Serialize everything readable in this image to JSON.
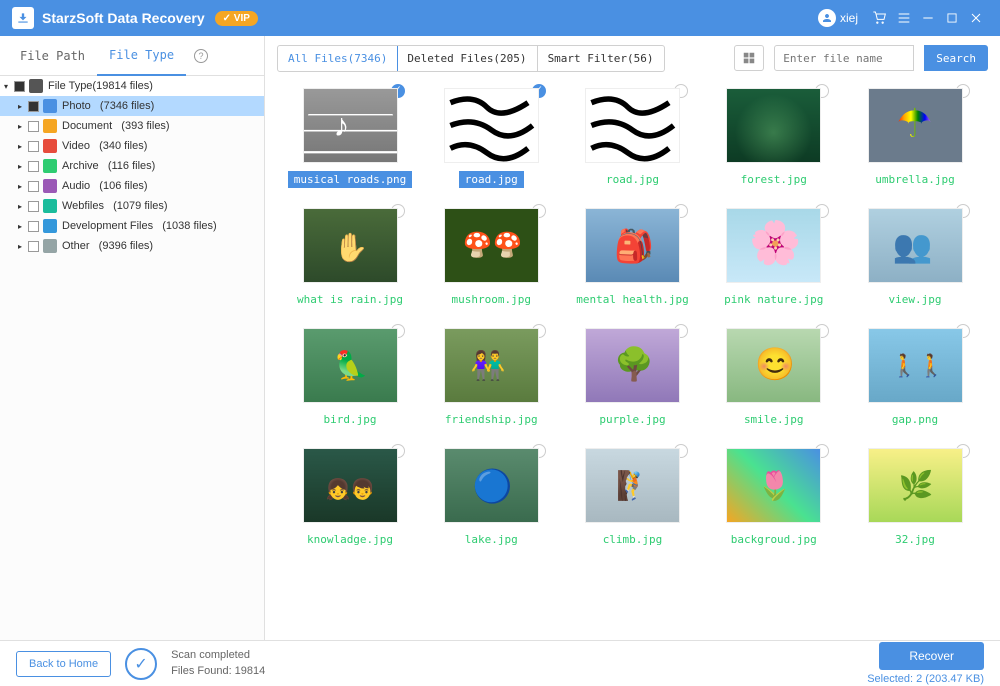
{
  "app": {
    "title": "StarzSoft Data Recovery",
    "vip": "VIP",
    "username": "xiej"
  },
  "sidebar": {
    "tabs": {
      "path": "File Path",
      "type": "File Type"
    },
    "root": "File Type(19814 files)",
    "items": [
      {
        "label": "Photo   (7346 files)",
        "color": "#4a90e2"
      },
      {
        "label": "Document   (393 files)",
        "color": "#f5a623"
      },
      {
        "label": "Video   (340 files)",
        "color": "#e74c3c"
      },
      {
        "label": "Archive   (116 files)",
        "color": "#2ecc71"
      },
      {
        "label": "Audio   (106 files)",
        "color": "#9b59b6"
      },
      {
        "label": "Webfiles   (1079 files)",
        "color": "#1abc9c"
      },
      {
        "label": "Development Files   (1038 files)",
        "color": "#3498db"
      },
      {
        "label": "Other   (9396 files)",
        "color": "#95a5a6"
      }
    ]
  },
  "toolbar": {
    "filters": {
      "all": "All Files(7346)",
      "deleted": "Deleted  Files(205)",
      "smart": "Smart Filter(56)"
    },
    "search_placeholder": "Enter file name",
    "search_btn": "Search"
  },
  "grid": [
    [
      {
        "name": "musical roads.png",
        "cls": "t-road",
        "selected": true
      },
      {
        "name": "road.jpg",
        "cls": "t-curves",
        "selected": true
      },
      {
        "name": "road.jpg",
        "cls": "t-curves",
        "selected": false
      },
      {
        "name": "forest.jpg",
        "cls": "t-forest",
        "selected": false
      },
      {
        "name": "umbrella.jpg",
        "cls": "t-umbrella",
        "selected": false
      }
    ],
    [
      {
        "name": "what is rain.jpg",
        "cls": "t-rain",
        "selected": false
      },
      {
        "name": "mushroom.jpg",
        "cls": "t-mushroom",
        "selected": false
      },
      {
        "name": "mental health.jpg",
        "cls": "t-mental",
        "selected": false
      },
      {
        "name": "pink nature.jpg",
        "cls": "t-pink",
        "selected": false
      },
      {
        "name": "view.jpg",
        "cls": "t-view",
        "selected": false
      }
    ],
    [
      {
        "name": "bird.jpg",
        "cls": "t-bird",
        "selected": false
      },
      {
        "name": "friendship.jpg",
        "cls": "t-friend",
        "selected": false
      },
      {
        "name": "purple.jpg",
        "cls": "t-purple",
        "selected": false
      },
      {
        "name": "smile.jpg",
        "cls": "t-smile",
        "selected": false
      },
      {
        "name": "gap.png",
        "cls": "t-gap",
        "selected": false
      }
    ],
    [
      {
        "name": "knowladge.jpg",
        "cls": "t-know",
        "selected": false
      },
      {
        "name": "lake.jpg",
        "cls": "t-lake",
        "selected": false
      },
      {
        "name": "climb.jpg",
        "cls": "t-climb",
        "selected": false
      },
      {
        "name": "backgroud.jpg",
        "cls": "t-bg",
        "selected": false
      },
      {
        "name": "32.jpg",
        "cls": "t-32",
        "selected": false
      }
    ]
  ],
  "footer": {
    "back": "Back to Home",
    "scan_status": "Scan completed",
    "files_found": "Files Found: 19814",
    "recover": "Recover",
    "selected_label": "Selected:",
    "selected_value": "2 (203.47 KB)"
  }
}
